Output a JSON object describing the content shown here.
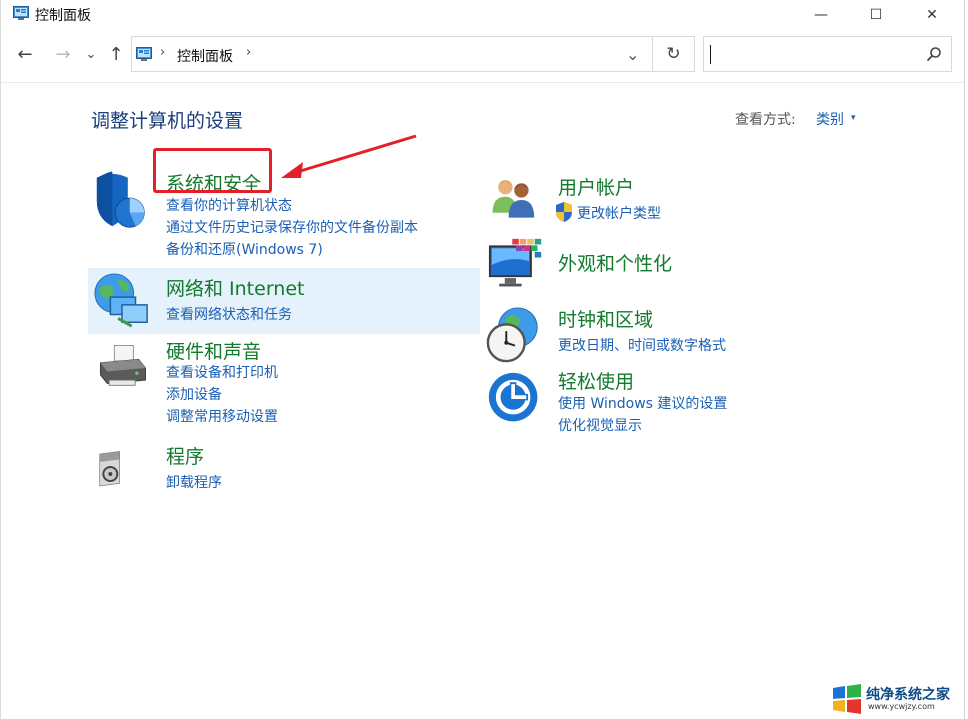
{
  "window": {
    "title": "控制面板",
    "minimize_glyph": "—",
    "maximize_glyph": "☐",
    "close_glyph": "✕"
  },
  "nav": {
    "back_glyph": "←",
    "forward_glyph": "→",
    "recent_glyph": "⌄",
    "up_glyph": "↑",
    "breadcrumb": "控制面板",
    "sep": "›",
    "dropdown_glyph": "⌄",
    "refresh_glyph": "↻",
    "search_value": ""
  },
  "content": {
    "heading": "调整计算机的设置",
    "view_by_label": "查看方式:",
    "view_by_value": "类别",
    "view_by_caret": "▾"
  },
  "categories": {
    "system_security": {
      "title": "系统和安全",
      "links": [
        "查看你的计算机状态",
        "通过文件历史记录保存你的文件备份副本",
        "备份和还原(Windows 7)"
      ]
    },
    "network": {
      "title": "网络和 Internet",
      "links": [
        "查看网络状态和任务"
      ]
    },
    "hardware": {
      "title": "硬件和声音",
      "links": [
        "查看设备和打印机",
        "添加设备",
        "调整常用移动设置"
      ]
    },
    "programs": {
      "title": "程序",
      "links": [
        "卸载程序"
      ]
    },
    "user_accounts": {
      "title": "用户帐户",
      "links": [
        "更改帐户类型"
      ]
    },
    "appearance": {
      "title": "外观和个性化",
      "links": []
    },
    "clock_region": {
      "title": "时钟和区域",
      "links": [
        "更改日期、时间或数字格式"
      ]
    },
    "ease_access": {
      "title": "轻松使用",
      "links": [
        "使用 Windows 建议的设置",
        "优化视觉显示"
      ]
    }
  },
  "watermark": {
    "title": "纯净系统之家",
    "url": "www.ycwjzy.com"
  },
  "colors": {
    "category_title": "#137a2d",
    "link": "#1a5fb4",
    "heading": "#1a3e7c",
    "highlight": "#e5f1fb",
    "annotation_red": "#e3202a"
  },
  "icons": {
    "app": "control-panel-icon",
    "system_security": "shield-icon",
    "network": "network-globe-icon",
    "hardware": "printer-icon",
    "programs": "programs-disc-icon",
    "user_accounts": "users-icon",
    "appearance": "monitor-palette-icon",
    "clock_region": "clock-globe-icon",
    "ease_access": "ease-of-access-icon",
    "uac_shield": "uac-shield-icon",
    "search": "search-icon"
  }
}
